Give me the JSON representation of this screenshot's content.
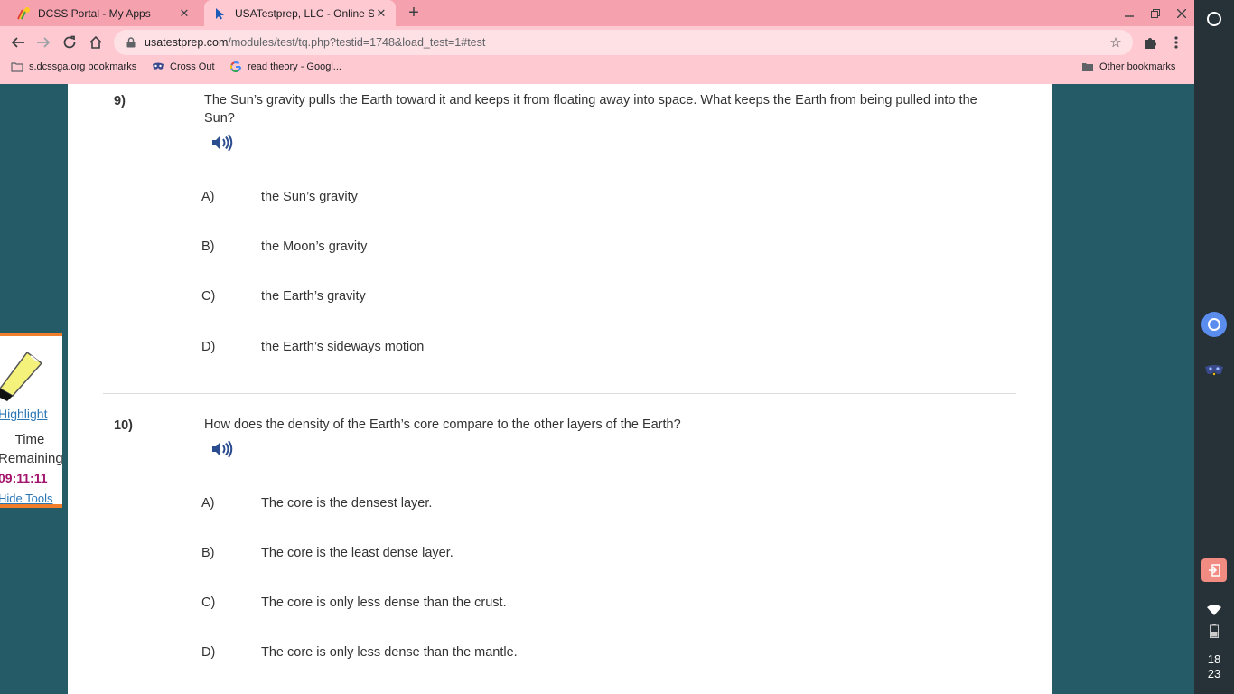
{
  "browser": {
    "tabs": [
      {
        "title": "DCSS Portal - My Apps",
        "active": false,
        "favicon": "rainbow-star-icon"
      },
      {
        "title": "USATestprep, LLC - Online State-S",
        "active": true,
        "favicon": "cursor-icon"
      }
    ],
    "url": {
      "host": "usatestprep.com",
      "path": "/modules/test/tq.php?testid=1748&load_test=1#test"
    },
    "bookmarks": [
      {
        "label": "s.dcssga.org bookmarks",
        "icon": "folder-icon"
      },
      {
        "label": "Cross Out",
        "icon": "mask-icon"
      },
      {
        "label": "read theory - Googl...",
        "icon": "google-icon"
      }
    ],
    "other_bookmarks": "Other bookmarks"
  },
  "questions": [
    {
      "number": "9)",
      "text": "The Sun’s gravity pulls the Earth toward it and keeps it from floating away into space. What keeps the Earth from being pulled into the Sun?",
      "options": [
        {
          "letter": "A)",
          "text": "the Sun’s gravity"
        },
        {
          "letter": "B)",
          "text": "the Moon’s gravity"
        },
        {
          "letter": "C)",
          "text": "the Earth’s gravity"
        },
        {
          "letter": "D)",
          "text": "the Earth’s sideways motion"
        }
      ]
    },
    {
      "number": "10)",
      "text": "How does the density of the Earth’s core compare to the other layers of the Earth?",
      "options": [
        {
          "letter": "A)",
          "text": "The core is the densest layer."
        },
        {
          "letter": "B)",
          "text": "The core is the least dense layer."
        },
        {
          "letter": "C)",
          "text": "The core is only less dense than the crust."
        },
        {
          "letter": "D)",
          "text": "The core is only less dense than the mantle."
        }
      ]
    }
  ],
  "tools": {
    "highlight": "Highlight",
    "time_label_1": "Time",
    "time_label_2": "Remaining",
    "time_value": "09:11:11",
    "hide_tools": "Hide Tools"
  },
  "shelf": {
    "clock_hour": "18",
    "clock_minute": "23"
  },
  "colors": {
    "tab_strip": "#f5a2ae",
    "toolbar": "#ffc9d1",
    "page_background": "#255b66",
    "tools_border": "#f07e2a",
    "timer": "#a3146c",
    "link": "#2a76b5"
  }
}
